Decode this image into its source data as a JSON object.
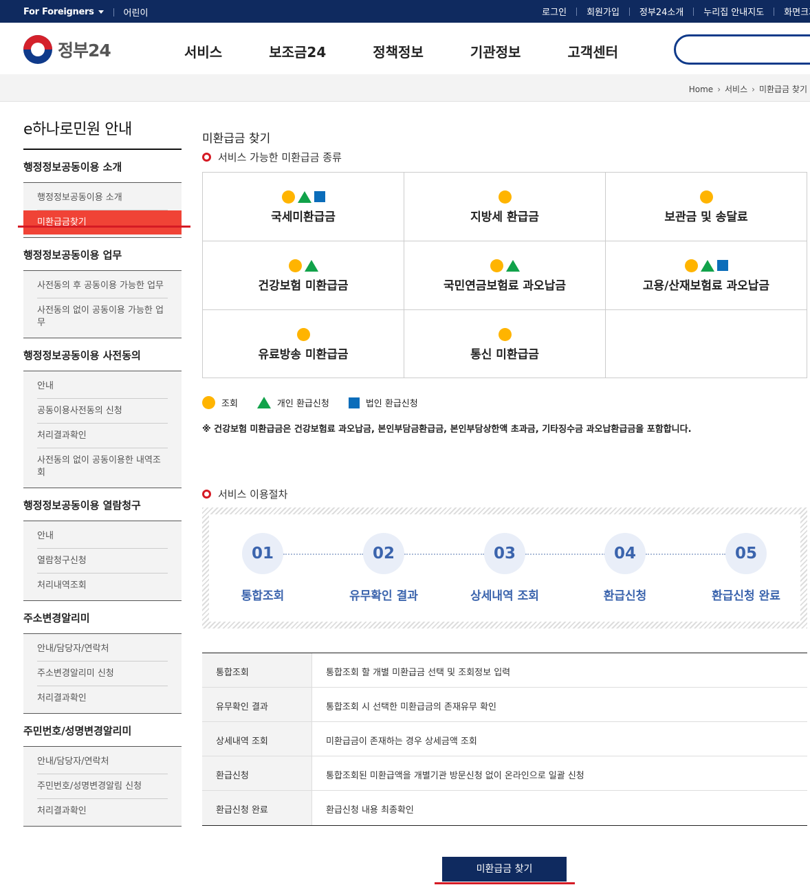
{
  "topbar": {
    "foreigners": "For Foreigners",
    "kids": "어린이",
    "links": [
      "로그인",
      "회원가입",
      "정부24소개",
      "누리집 안내지도",
      "화면크기"
    ]
  },
  "header": {
    "logo_text": "정부24",
    "nav": [
      "서비스",
      "보조금24",
      "정책정보",
      "기관정보",
      "고객센터"
    ]
  },
  "breadcrumb": [
    "Home",
    "서비스",
    "미환급금 찾기"
  ],
  "sidebar": {
    "title": "e하나로민원 안내",
    "groups": [
      {
        "title": "행정정보공동이용 소개",
        "items": [
          "행정정보공동이용 소개",
          "미환급금찾기"
        ]
      },
      {
        "title": "행정정보공동이용 업무",
        "items": [
          "사전동의 후 공동이용 가능한 업무",
          "사전동의 없이 공동이용 가능한 업무"
        ]
      },
      {
        "title": "행정정보공동이용 사전동의",
        "items": [
          "안내",
          "공동이용사전동의 신청",
          "처리결과확인",
          "사전동의 없이 공동이용한 내역조회"
        ]
      },
      {
        "title": "행정정보공동이용 열람청구",
        "items": [
          "안내",
          "열람청구신청",
          "처리내역조회"
        ]
      },
      {
        "title": "주소변경알리미",
        "items": [
          "안내/담당자/연락처",
          "주소변경알리미 신청",
          "처리결과확인"
        ]
      },
      {
        "title": "주민번호/성명변경알리미",
        "items": [
          "안내/담당자/연락처",
          "주민번호/성명변경알림 신청",
          "처리결과확인"
        ]
      }
    ]
  },
  "main": {
    "page_title": "미환급금 찾기",
    "section1_title": "서비스 가능한 미환급금 종류",
    "cards": [
      {
        "name": "국세미환급금",
        "icons": [
          "circle",
          "triangle",
          "square"
        ]
      },
      {
        "name": "지방세 환급금",
        "icons": [
          "circle"
        ]
      },
      {
        "name": "보관금 및 송달료",
        "icons": [
          "circle"
        ]
      },
      {
        "name": "건강보험 미환급금",
        "icons": [
          "circle",
          "triangle"
        ]
      },
      {
        "name": "국민연금보험료 과오납금",
        "icons": [
          "circle",
          "triangle"
        ]
      },
      {
        "name": "고용/산재보험료 과오납금",
        "icons": [
          "circle",
          "triangle",
          "square"
        ]
      },
      {
        "name": "유료방송 미환급금",
        "icons": [
          "circle"
        ]
      },
      {
        "name": "통신 미환급금",
        "icons": [
          "circle"
        ]
      }
    ],
    "legend": {
      "circle": "조회",
      "triangle": "개인 환급신청",
      "square": "법인 환급신청"
    },
    "note": "※ 건강보험 미환급금은 건강보험료 과오납금, 본인부담금환급금, 본인부담상한액 초과금, 기타징수금 과오납환급금을 포함합니다.",
    "section2_title": "서비스 이용절차",
    "steps": [
      {
        "num": "01",
        "label": "통합조회"
      },
      {
        "num": "02",
        "label": "유무확인 결과"
      },
      {
        "num": "03",
        "label": "상세내역 조회"
      },
      {
        "num": "04",
        "label": "환급신청"
      },
      {
        "num": "05",
        "label": "환급신청 완료"
      }
    ],
    "table": [
      {
        "th": "통합조회",
        "td": "통합조회 할 개별 미환급금 선택 및 조회정보 입력"
      },
      {
        "th": "유무확인 결과",
        "td": "통합조회 시 선택한 미환급금의 존재유무 확인"
      },
      {
        "th": "상세내역 조회",
        "td": "미환급금이 존재하는 경우 상세금액 조회"
      },
      {
        "th": "환급신청",
        "td": "통합조회된 미환급액을 개별기관 방문신청 없이 온라인으로 일괄 신청"
      },
      {
        "th": "환급신청 완료",
        "td": "환급신청 내용 최종확인"
      }
    ],
    "button": "미환급금 찾기"
  },
  "colors": {
    "navy": "#0f2a5f",
    "active_red": "#f04336",
    "circle": "#ffb400",
    "triangle": "#11a24a",
    "square": "#0b6dba",
    "step_blue": "#3b64ad"
  }
}
